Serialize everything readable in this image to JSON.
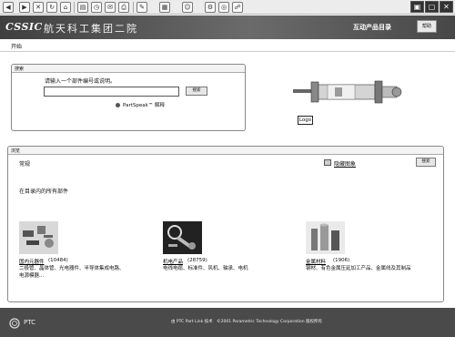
{
  "toolbar": {
    "icons": [
      "back-icon",
      "forward-icon",
      "stop-icon",
      "refresh-icon",
      "home-icon",
      "pane-icon",
      "history-icon",
      "mail-icon",
      "print-icon",
      "edit-icon",
      "discuss-icon",
      "messenger-icon",
      "tools-icon"
    ]
  },
  "header": {
    "logo": "CSSIC",
    "company": "航天科工集团二院",
    "catalog_title": "互动产品目录",
    "help_button": "帮助"
  },
  "nav": {
    "start": "开始"
  },
  "search": {
    "title": "搜索",
    "prompt": "请输入一个部件编号或说明。",
    "input_value": "",
    "button": "搜索",
    "partspeak_link": "PartSpeak™ 解释"
  },
  "illustration": {
    "logo_label": "Logo"
  },
  "browse": {
    "title": "浏览",
    "common": "常规",
    "hide_link": "隐藏图象",
    "search_button": "搜索",
    "all_parts": "在目录内的所有部件",
    "categories": [
      {
        "name": "国内元器件",
        "count": "(10484)",
        "desc": "二极管、晶体管、光电器件、半导体集成电路、电源模器..."
      },
      {
        "name": "机电产品",
        "count": "(28759)",
        "desc": "电线电缆、标准件、风机、轴承、电机"
      },
      {
        "name": "金属材料",
        "count": "(1906)",
        "desc": "钢材、有色金属压延加工产品、金属线及其制品"
      }
    ]
  },
  "footer": {
    "logo": "PTC",
    "text": "由 PTC Part Link 技术　©2001 Parametric Technology Corporation 版权所有"
  },
  "colors": {
    "header": "#555555",
    "footer": "#4a4a4a",
    "panel_border": "#888888"
  }
}
